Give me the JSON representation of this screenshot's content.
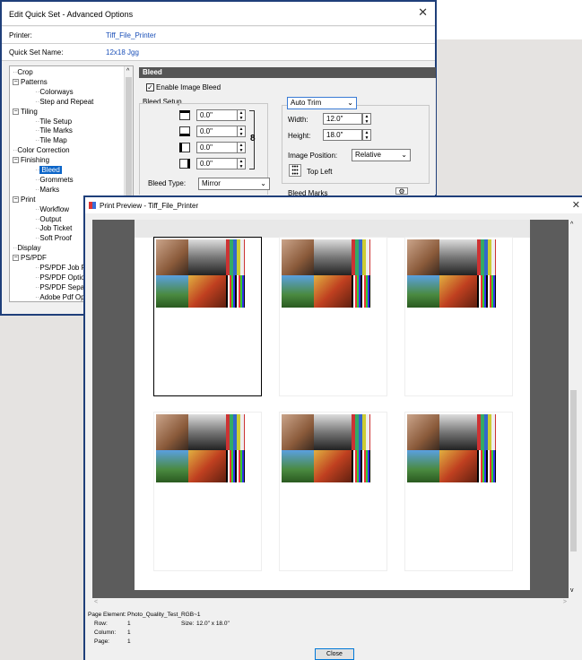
{
  "quick_set_dialog": {
    "title": "Edit Quick Set - Advanced Options",
    "printer_label": "Printer:",
    "printer_value": "Tiff_File_Printer",
    "quickset_label": "Quick Set Name:",
    "quickset_value": "12x18 Jgg",
    "tree": [
      {
        "label": "Crop",
        "level": 0,
        "expander": ""
      },
      {
        "label": "Patterns",
        "level": 0,
        "expander": "−"
      },
      {
        "label": "Colorways",
        "level": 1,
        "expander": ""
      },
      {
        "label": "Step and Repeat",
        "level": 1,
        "expander": ""
      },
      {
        "label": "Tiling",
        "level": 0,
        "expander": "−"
      },
      {
        "label": "Tile Setup",
        "level": 1,
        "expander": ""
      },
      {
        "label": "Tile Marks",
        "level": 1,
        "expander": ""
      },
      {
        "label": "Tile Map",
        "level": 1,
        "expander": ""
      },
      {
        "label": "Color Correction",
        "level": 0,
        "expander": ""
      },
      {
        "label": "Finishing",
        "level": 0,
        "expander": "−"
      },
      {
        "label": "Bleed",
        "level": 1,
        "expander": "",
        "selected": true
      },
      {
        "label": "Grommets",
        "level": 1,
        "expander": ""
      },
      {
        "label": "Marks",
        "level": 1,
        "expander": ""
      },
      {
        "label": "Print",
        "level": 0,
        "expander": "−"
      },
      {
        "label": "Workflow",
        "level": 1,
        "expander": ""
      },
      {
        "label": "Output",
        "level": 1,
        "expander": ""
      },
      {
        "label": "Job Ticket",
        "level": 1,
        "expander": ""
      },
      {
        "label": "Soft Proof",
        "level": 1,
        "expander": ""
      },
      {
        "label": "Display",
        "level": 0,
        "expander": ""
      },
      {
        "label": "PS/PDF",
        "level": 0,
        "expander": "−"
      },
      {
        "label": "PS/PDF Job File",
        "level": 1,
        "expander": ""
      },
      {
        "label": "PS/PDF Options",
        "level": 1,
        "expander": ""
      },
      {
        "label": "PS/PDF Separa",
        "level": 1,
        "expander": ""
      },
      {
        "label": "Adobe Pdf Opti",
        "level": 1,
        "expander": ""
      }
    ],
    "bleed": {
      "header": "Bleed",
      "enable_label": "Enable Image Bleed",
      "enable_checked": "✓",
      "setup_label": "Bleed Setup",
      "values": [
        "0.0\"",
        "0.0\"",
        "0.0\"",
        "0.0\""
      ],
      "type_label": "Bleed Type:",
      "type_value": "Mirror",
      "trim_value": "Auto Trim",
      "width_label": "Width:",
      "width_value": "12.0\"",
      "height_label": "Height:",
      "height_value": "18.0\"",
      "position_label": "Image Position:",
      "position_value": "Relative",
      "anchor_label": "Top Left",
      "marks_label": "Bleed Marks"
    }
  },
  "preview_dialog": {
    "title": "Print Preview - Tiff_File_Printer",
    "page_element_label": "Page Element:",
    "page_element_value": "Photo_Quality_Test_RGB~1",
    "row_label": "Row:",
    "row_value": "1",
    "size_label": "Size:",
    "size_value": "12.0\" x 18.0\"",
    "column_label": "Column:",
    "column_value": "1",
    "page_label": "Page:",
    "page_value": "1",
    "close_label": "Close",
    "grid": {
      "rows": 2,
      "columns": 3,
      "selected_row": 1,
      "selected_column": 1
    }
  },
  "icons": [
    "close-icon",
    "chain-link-icon",
    "chevron-down-icon",
    "anchor-grid-icon",
    "gear-icon"
  ],
  "colors": {
    "accent_blue": "#0a64c8",
    "window_border": "#1f3f7a",
    "panel_header": "#555555",
    "canvas_gray": "#5c5c5c"
  }
}
